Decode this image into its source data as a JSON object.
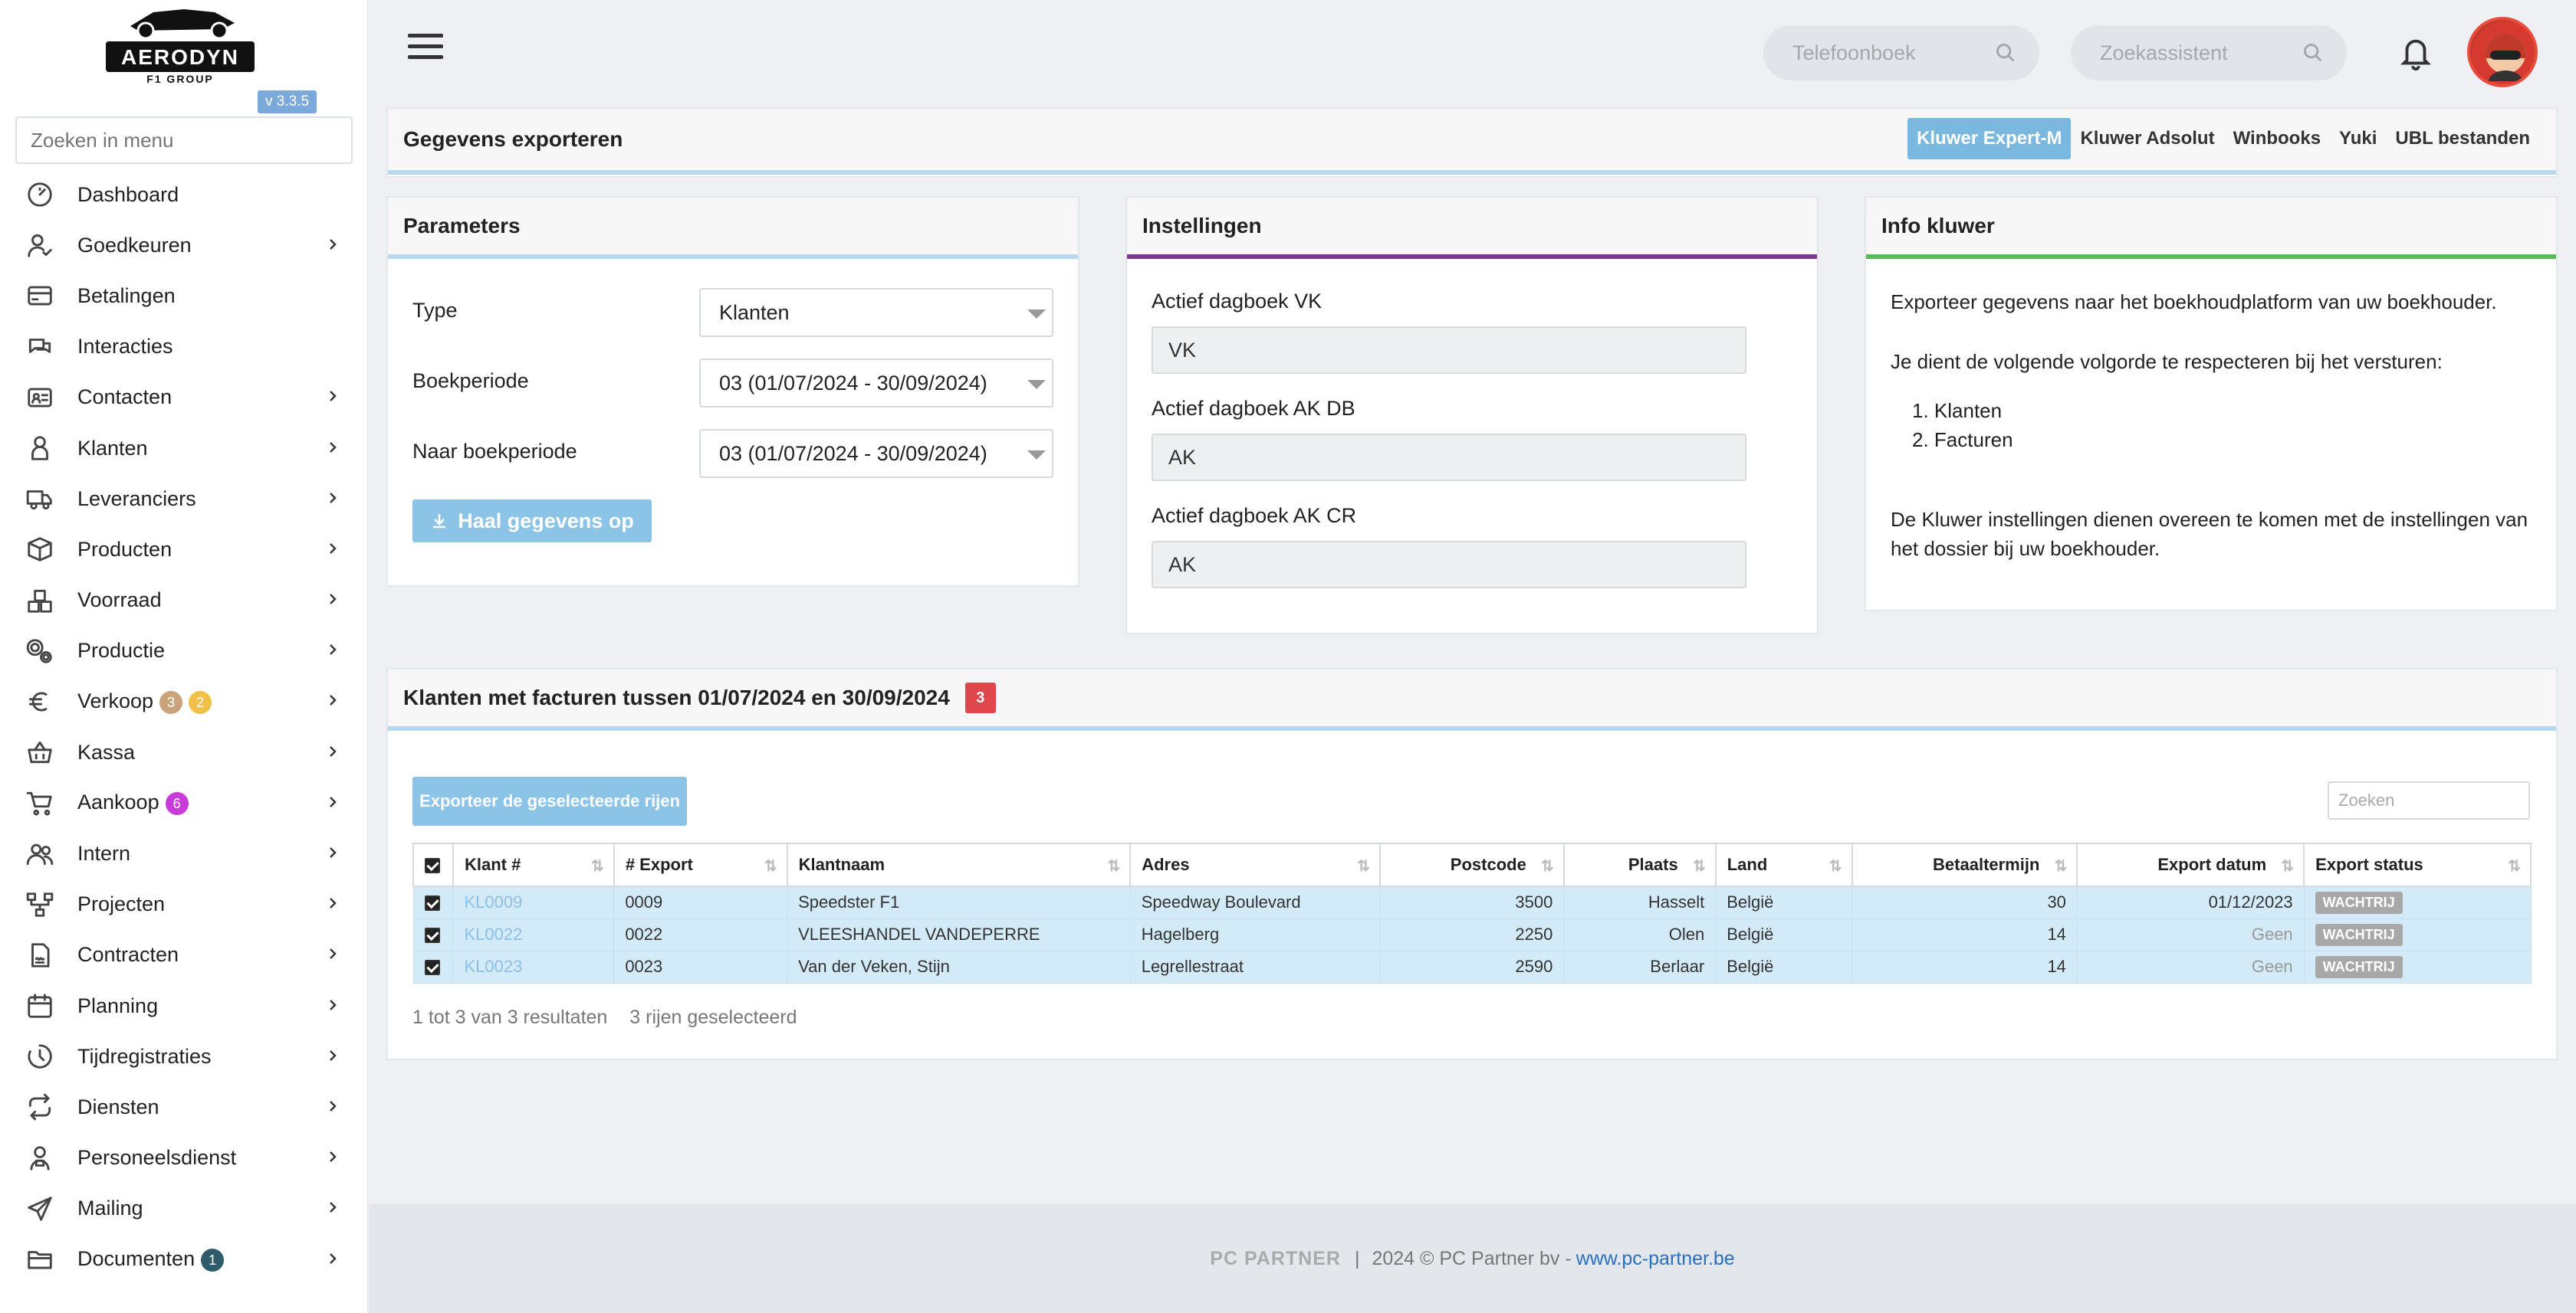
{
  "sidebar": {
    "logo_text": "AERODYN",
    "logo_sub": "F1 GROUP",
    "version": "v 3.3.5",
    "search_placeholder": "Zoeken in menu",
    "items": [
      {
        "label": "Dashboard",
        "icon": "dashboard-icon",
        "chevron": false
      },
      {
        "label": "Goedkeuren",
        "icon": "user-check-icon",
        "chevron": true
      },
      {
        "label": "Betalingen",
        "icon": "credit-card-icon",
        "chevron": false
      },
      {
        "label": "Interacties",
        "icon": "chat-icon",
        "chevron": false
      },
      {
        "label": "Contacten",
        "icon": "contact-card-icon",
        "chevron": true
      },
      {
        "label": "Klanten",
        "icon": "customer-icon",
        "chevron": true
      },
      {
        "label": "Leveranciers",
        "icon": "truck-icon",
        "chevron": true
      },
      {
        "label": "Producten",
        "icon": "box-icon",
        "chevron": true
      },
      {
        "label": "Voorraad",
        "icon": "boxes-icon",
        "chevron": true
      },
      {
        "label": "Productie",
        "icon": "gears-icon",
        "chevron": true
      },
      {
        "label": "Verkoop",
        "icon": "euro-icon",
        "chevron": true,
        "badges": [
          {
            "value": "3",
            "color": "#c9a37b"
          },
          {
            "value": "2",
            "color": "#f0c04a"
          }
        ]
      },
      {
        "label": "Kassa",
        "icon": "basket-icon",
        "chevron": true
      },
      {
        "label": "Aankoop",
        "icon": "cart-icon",
        "chevron": true,
        "badges": [
          {
            "value": "6",
            "color": "#c83bd8"
          }
        ]
      },
      {
        "label": "Intern",
        "icon": "users-icon",
        "chevron": true
      },
      {
        "label": "Projecten",
        "icon": "project-icon",
        "chevron": true
      },
      {
        "label": "Contracten",
        "icon": "contract-icon",
        "chevron": true
      },
      {
        "label": "Planning",
        "icon": "calendar-icon",
        "chevron": true
      },
      {
        "label": "Tijdregistraties",
        "icon": "timer-icon",
        "chevron": true
      },
      {
        "label": "Diensten",
        "icon": "repeat-icon",
        "chevron": true
      },
      {
        "label": "Personeelsdienst",
        "icon": "person-icon",
        "chevron": true
      },
      {
        "label": "Mailing",
        "icon": "send-icon",
        "chevron": true
      },
      {
        "label": "Documenten",
        "icon": "folder-icon",
        "chevron": true,
        "badges": [
          {
            "value": "1",
            "color": "#2f5b6b"
          }
        ]
      }
    ]
  },
  "topbar": {
    "phonebook_placeholder": "Telefoonboek",
    "assistant_placeholder": "Zoekassistent"
  },
  "export_panel": {
    "title": "Gegevens exporteren",
    "tabs": [
      "Kluwer Expert-M",
      "Kluwer Adsolut",
      "Winbooks",
      "Yuki",
      "UBL bestanden"
    ],
    "active_tab": 0
  },
  "parameters": {
    "title": "Parameters",
    "type_label": "Type",
    "type_value": "Klanten",
    "period_label": "Boekperiode",
    "period_value": "03 (01/07/2024 - 30/09/2024)",
    "to_period_label": "Naar boekperiode",
    "to_period_value": "03 (01/07/2024 - 30/09/2024)",
    "fetch_button": "Haal gegevens op"
  },
  "settings": {
    "title": "Instellingen",
    "vk_label": "Actief dagboek VK",
    "vk_value": "VK",
    "akdb_label": "Actief dagboek AK DB",
    "akdb_value": "AK",
    "akcr_label": "Actief dagboek AK CR",
    "akcr_value": "AK"
  },
  "info": {
    "title": "Info kluwer",
    "line1": "Exporteer gegevens naar het boekhoudplatform van uw boekhouder.",
    "line2": "Je dient de volgende volgorde te respecteren bij het versturen:",
    "step1": "Klanten",
    "step2": "Facturen",
    "line3a": "De Kluwer instellingen dienen overeen te komen met de instellingen van",
    "line3b": "het dossier bij uw boekhouder."
  },
  "results_panel": {
    "title": "Klanten met facturen tussen 01/07/2024 en 30/09/2024",
    "count": "3",
    "export_button": "Exporteer de geselecteerde rijen",
    "search_placeholder": "Zoeken",
    "columns": [
      "Klant #",
      "# Export",
      "Klantnaam",
      "Adres",
      "Postcode",
      "Plaats",
      "Land",
      "Betaaltermijn",
      "Export datum",
      "Export status"
    ],
    "rows": [
      {
        "klant": "KL0009",
        "export": "0009",
        "naam": "Speedster F1",
        "adres": "Speedway Boulevard",
        "postcode": "3500",
        "plaats": "Hasselt",
        "land": "België",
        "termijn": "30",
        "datum": "01/12/2023",
        "status": "WACHTRIJ"
      },
      {
        "klant": "KL0022",
        "export": "0022",
        "naam": "VLEESHANDEL VANDEPERRE",
        "adres": "Hagelberg",
        "postcode": "2250",
        "plaats": "Olen",
        "land": "België",
        "termijn": "14",
        "datum": "Geen",
        "status": "WACHTRIJ"
      },
      {
        "klant": "KL0023",
        "export": "0023",
        "naam": "Van der Veken, Stijn",
        "adres": "Legrellestraat",
        "postcode": "2590",
        "plaats": "Berlaar",
        "land": "België",
        "termijn": "14",
        "datum": "Geen",
        "status": "WACHTRIJ"
      }
    ],
    "summary": "1 tot 3 van 3 resultaten",
    "selected": "3 rijen geselecteerd"
  },
  "footer": {
    "brand": "PC PARTNER",
    "text": "2024 © PC Partner bv - ",
    "link": "www.pc-partner.be"
  }
}
